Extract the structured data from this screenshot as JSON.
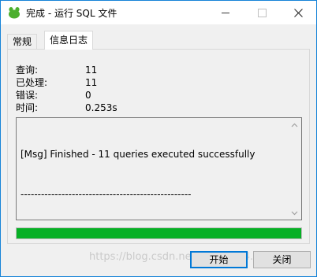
{
  "window": {
    "title": "完成 - 运行 SQL 文件",
    "accent_color": "#1683d8",
    "app_icon": "navicat-leaf-icon",
    "controls": {
      "minimize": "minimize-icon",
      "maximize": "maximize-icon",
      "close": "close-icon"
    }
  },
  "tabs": [
    {
      "label": "常规",
      "active": false
    },
    {
      "label": "信息日志",
      "active": true
    }
  ],
  "stats": {
    "query_label": "查询:",
    "query_value": "11",
    "processed_label": "已处理:",
    "processed_value": "11",
    "error_label": "错误:",
    "error_value": "0",
    "time_label": "时间:",
    "time_value": "0.253s"
  },
  "log": {
    "lines": [
      "[Msg] Finished - 11 queries executed successfully",
      "--------------------------------------------------"
    ]
  },
  "progress": {
    "percent": 100,
    "color": "#06b025"
  },
  "buttons": {
    "start": "开始",
    "close": "关闭"
  },
  "watermark": "https://blog.csdn.net/weixin_44…129"
}
